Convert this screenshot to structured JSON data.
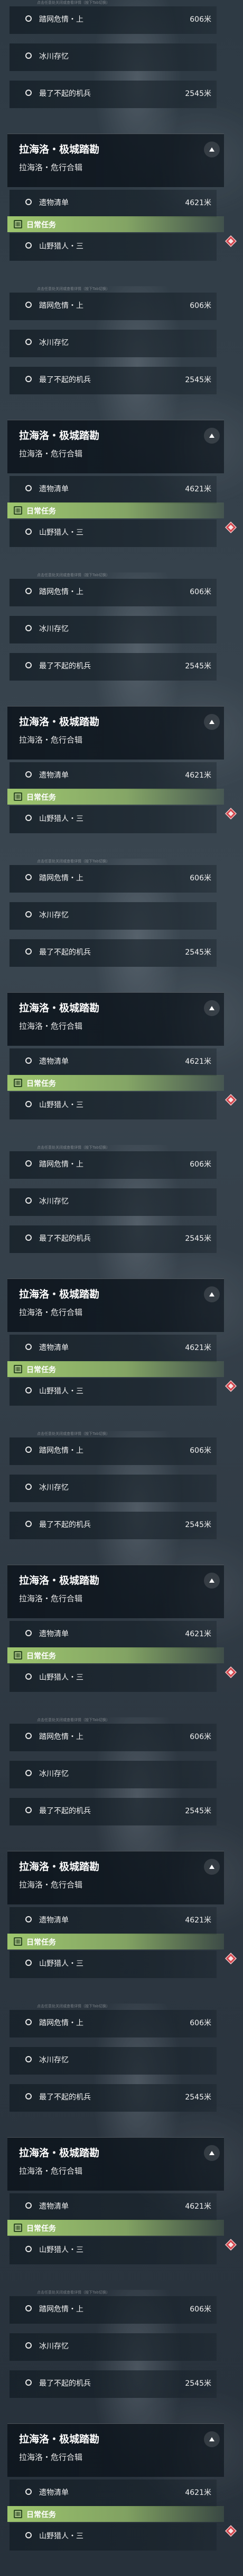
{
  "panels_count": 9,
  "quest_tracker": {
    "hint_text": "点击任意处关闭或查看详情（按下Tab切换）",
    "items_top": [
      {
        "name": "踏网危情・上",
        "distance": "606米"
      },
      {
        "name": "冰川存忆",
        "distance": ""
      },
      {
        "name": "最了不起的机兵",
        "distance": "2545米"
      }
    ],
    "main_quest": {
      "title": "拉海洛・极城踏勘",
      "subtitle": "拉海洛・危行合辑"
    },
    "item_main": {
      "name": "遗物清单",
      "distance": "4621米"
    },
    "daily_label": "日常任务",
    "item_daily": {
      "name": "山野猎人・三",
      "distance": ""
    }
  },
  "icons": [
    "radio-circle-icon",
    "chevron-up-icon",
    "daily-quest-icon",
    "waypoint-marker-icon"
  ],
  "colors": {
    "daily_bar": "#9ec66e",
    "marker_red": "#d2434a",
    "panel_dark": "#0e161e"
  }
}
